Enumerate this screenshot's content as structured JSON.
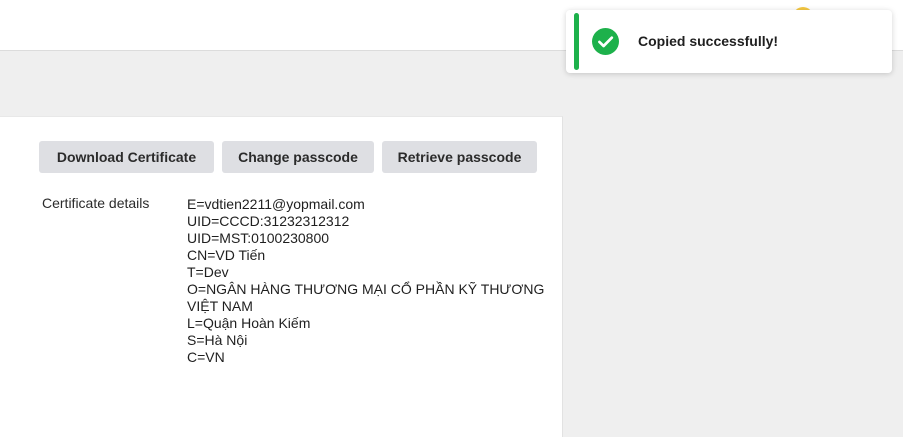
{
  "colors": {
    "success": "#1db14b",
    "button_bg": "#dedfe3",
    "page_bg": "#efefef",
    "avatar": "#f5c842"
  },
  "header": {
    "avatar_icon": "user-avatar-icon"
  },
  "actions": {
    "download_label": "Download Certificate",
    "change_label": "Change passcode",
    "retrieve_label": "Retrieve passcode"
  },
  "certificate": {
    "label": "Certificate details",
    "lines": [
      "E=vdtien2211@yopmail.com",
      "UID=CCCD:31232312312",
      "UID=MST:0100230800",
      "CN=VD Tiến",
      "T=Dev",
      "O=NGÂN HÀNG THƯƠNG MẠI CỔ PHẦN KỸ THƯƠNG VIỆT NAM",
      "L=Quận Hoàn Kiếm",
      "S=Hà Nội",
      "C=VN"
    ]
  },
  "toast": {
    "icon": "check-circle-icon",
    "message": "Copied successfully!"
  }
}
